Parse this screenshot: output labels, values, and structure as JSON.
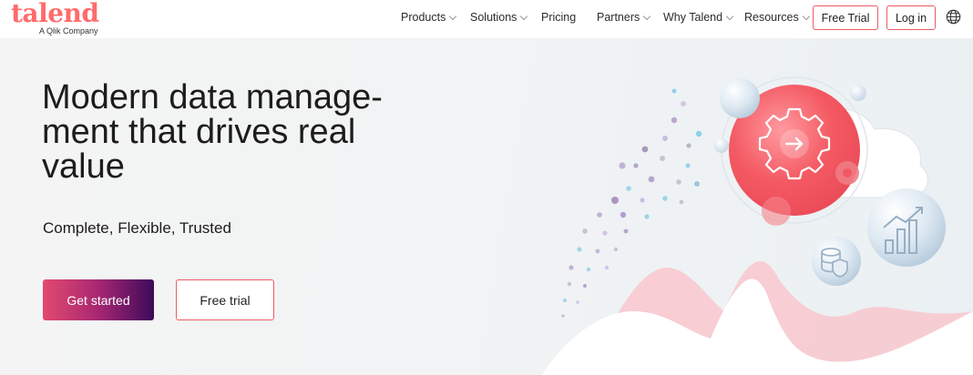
{
  "brand": {
    "name": "talend",
    "tagline": "A Qlik Company",
    "color": "#ff6b6b"
  },
  "nav": {
    "items": [
      {
        "label": "Products",
        "has_menu": true
      },
      {
        "label": "Solutions",
        "has_menu": true
      },
      {
        "label": "Pricing",
        "has_menu": false
      },
      {
        "label": "Partners",
        "has_menu": true
      },
      {
        "label": "Why Talend",
        "has_menu": true
      },
      {
        "label": "Resources",
        "has_menu": true
      }
    ],
    "free_trial_label": "Free Trial",
    "login_label": "Log in",
    "language_icon": "globe-icon"
  },
  "hero": {
    "headline_lines": [
      "Modern data manage-",
      "ment that drives real",
      "value"
    ],
    "subheadline": "Complete, Flexible, Trusted",
    "primary_cta": "Get started",
    "secondary_cta": "Free trial"
  },
  "illustration": {
    "icons": [
      "gear-icon",
      "arrow-right-icon",
      "database-shield-icon",
      "chart-growth-icon"
    ]
  },
  "colors": {
    "accent": "#ee5a66",
    "cta_gradient_start": "#e24a6e",
    "cta_gradient_end": "#3d0a5a",
    "hero_circle": "#f25b63"
  }
}
